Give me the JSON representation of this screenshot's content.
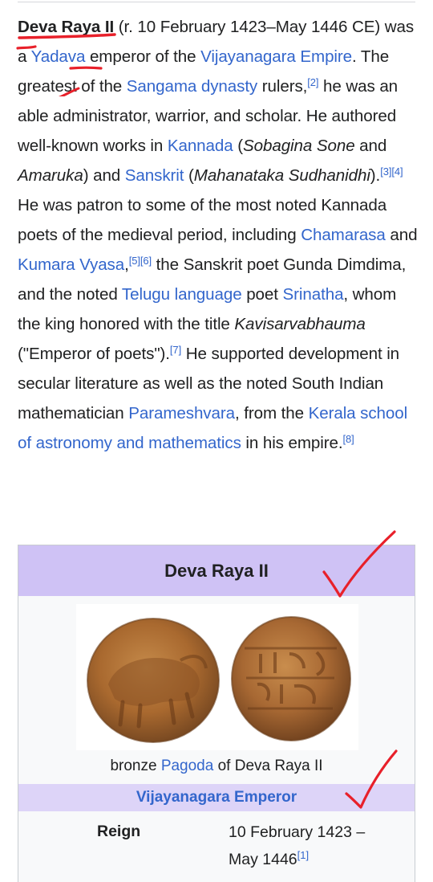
{
  "article": {
    "subject_bold": "Deva Raya II",
    "reign_text": " (r. 10 February 1423–May 1446 CE) was a ",
    "link_yadava": "Yadava",
    "t_emperor_of": " emperor of the ",
    "link_vijayanagara_empire": "Vijayanagara Empire",
    "t_greatest": ". The greatest of the ",
    "link_sangama": "Sangama dynasty",
    "t_rulers": " rulers,",
    "ref_2": "[2]",
    "t_able": " he was an able administrator, warrior, and scholar. He authored well-known works in ",
    "link_kannada": "Kannada",
    "t_paren_open": " (",
    "work_sobagina": "Sobagina Sone",
    "t_and": " and ",
    "work_amaruka": "Amaruka",
    "t_paren_close_and": ") and ",
    "link_sanskrit": "Sanskrit",
    "t_paren_open2": " (",
    "work_mahanataka": "Mahanataka Sudhanidhi",
    "t_paren_close": ").",
    "ref_3": "[3]",
    "ref_4": "[4]",
    "t_patron": " He was patron to some of the most noted Kannada poets of the medieval period, including ",
    "link_chamarasa": "Chamarasa",
    "t_and2": " and ",
    "link_kumara_vyasa": "Kumara Vyasa",
    "t_comma": ",",
    "ref_5": "[5]",
    "ref_6": "[6]",
    "t_sanskrit_poet": " the Sanskrit poet Gunda Dimdima, and the noted ",
    "link_telugu": "Telugu language",
    "t_poet": " poet ",
    "link_srinatha": "Srinatha",
    "t_honored": ", whom the king honored with the title ",
    "title_kavisarvabhauma": "Kavisarvabhauma",
    "t_emperor_poets": " (\"Emperor of poets\").",
    "ref_7": "[7]",
    "t_supported": " He supported development in secular literature as well as the noted South Indian mathematician ",
    "link_parameshvara": "Parameshvara",
    "t_from_the": ", from the ",
    "link_kerala_school": "Kerala school of astronomy and mathematics",
    "t_in_empire": " in his empire.",
    "ref_8": "[8]"
  },
  "infobox": {
    "title": "Deva Raya II",
    "caption_prefix": "bronze ",
    "caption_link": "Pagoda",
    "caption_suffix": " of Deva Raya II",
    "section_header": "Vijayanagara Emperor",
    "reign_label": "Reign",
    "reign_value": "10 February 1423 – May 1446",
    "reign_ref": "[1]"
  },
  "colors": {
    "link": "#3366cc",
    "infobox_title_bg": "#cfc2f5",
    "infobox_section_bg": "#ddd4f8",
    "annotation_red": "#e8202a"
  }
}
